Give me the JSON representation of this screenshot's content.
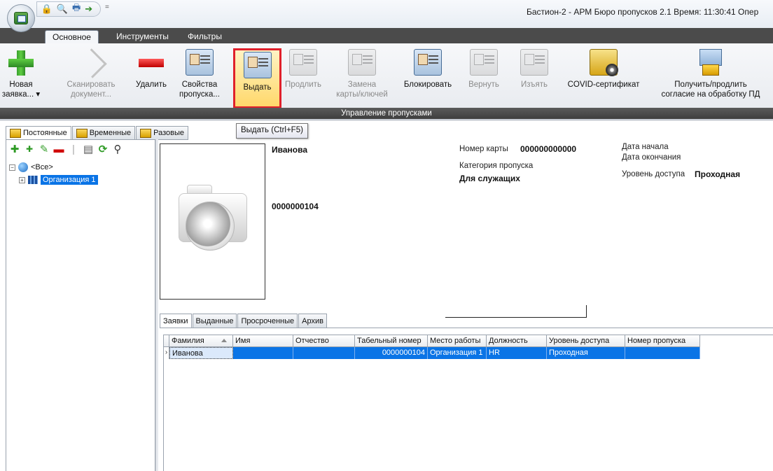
{
  "window": {
    "title": "Бастион-2 - АРМ Бюро пропусков 2.1 Время: 11:30:41 Опер",
    "qat_separator": "="
  },
  "ribbon_tabs": [
    "Основное",
    "Инструменты",
    "Фильтры"
  ],
  "ribbon": {
    "buttons": [
      {
        "label": "Новая\nзаявка... ▾",
        "enabled": true
      },
      {
        "label": "Сканировать\nдокумент...",
        "enabled": false
      },
      {
        "label": "Удалить",
        "enabled": true
      },
      {
        "label": "Свойства\nпропуска...",
        "enabled": true
      },
      {
        "label": "Выдать",
        "enabled": true
      },
      {
        "label": "Продлить",
        "enabled": false
      },
      {
        "label": "Замена\nкарты/ключей",
        "enabled": false
      },
      {
        "label": "Блокировать",
        "enabled": true
      },
      {
        "label": "Вернуть",
        "enabled": false
      },
      {
        "label": "Изъять",
        "enabled": false
      },
      {
        "label": "COVID-сертификат",
        "enabled": true
      },
      {
        "label": "Получить/продлить\nсогласие на обработку ПД",
        "enabled": true
      }
    ],
    "group_label": "Управление пропусками"
  },
  "tooltip": "Выдать (Ctrl+F5)",
  "left_tabs": [
    "Постоянные",
    "Временные",
    "Разовые"
  ],
  "left_toolbar_icons": [
    "add-icon",
    "add-subitem-icon",
    "edit-icon",
    "delete-icon",
    "document-icon",
    "refresh-icon",
    "search-icon"
  ],
  "tree": {
    "root": "<Все>",
    "child": "Организация 1"
  },
  "card": {
    "surname": "Иванова",
    "employee_number": "0000000104",
    "card_number_label": "Номер карты",
    "card_number": "000000000000",
    "category_label": "Категория пропуска",
    "category": "Для служащих",
    "start_date_label": "Дата начала",
    "end_date_label": "Дата окончания",
    "access_level_label": "Уровень доступа",
    "access_level": "Проходная"
  },
  "bottom_tabs": [
    "Заявки",
    "Выданные",
    "Просроченные",
    "Архив"
  ],
  "grid": {
    "columns": [
      "Фамилия",
      "Имя",
      "Отчество",
      "Табельный номер",
      "Место работы",
      "Должность",
      "Уровень доступа",
      "Номер пропуска"
    ],
    "rows": [
      [
        "Иванова",
        "",
        "",
        "0000000104",
        "Организация 1",
        "HR",
        "Проходная",
        ""
      ]
    ]
  },
  "colors": {
    "selection": "#0a74e6",
    "highlight_border": "#e0202a",
    "ribbon_tabbar": "#4b4b4b"
  }
}
